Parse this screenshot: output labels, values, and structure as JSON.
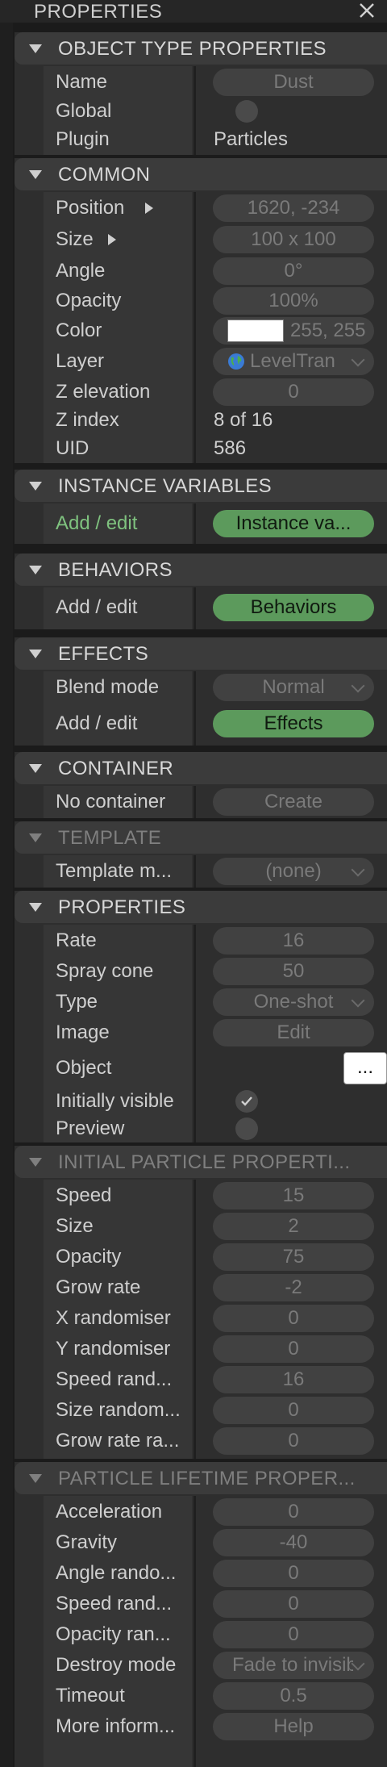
{
  "panel": {
    "title": "PROPERTIES"
  },
  "object_type": {
    "header": "OBJECT TYPE PROPERTIES",
    "name_label": "Name",
    "name_value": "Dust",
    "global_label": "Global",
    "plugin_label": "Plugin",
    "plugin_value": "Particles"
  },
  "common": {
    "header": "COMMON",
    "position_label": "Position",
    "position_value": "1620, -234",
    "size_label": "Size",
    "size_value": "100 x 100",
    "angle_label": "Angle",
    "angle_value": "0°",
    "opacity_label": "Opacity",
    "opacity_value": "100%",
    "color_label": "Color",
    "color_value": "255, 255",
    "color_swatch": "#ffffff",
    "layer_label": "Layer",
    "layer_value": "LevelTran",
    "zelev_label": "Z elevation",
    "zelev_value": "0",
    "zindex_label": "Z index",
    "zindex_value": "8 of 16",
    "uid_label": "UID",
    "uid_value": "586"
  },
  "instance_vars": {
    "header": "INSTANCE VARIABLES",
    "add_label": "Add / edit",
    "button": "Instance va..."
  },
  "behaviors": {
    "header": "BEHAVIORS",
    "add_label": "Add / edit",
    "button": "Behaviors"
  },
  "effects": {
    "header": "EFFECTS",
    "blend_label": "Blend mode",
    "blend_value": "Normal",
    "add_label": "Add / edit",
    "button": "Effects"
  },
  "container": {
    "header": "CONTAINER",
    "label": "No container",
    "button": "Create"
  },
  "template": {
    "header": "TEMPLATE",
    "label": "Template m...",
    "value": "(none)"
  },
  "properties": {
    "header": "PROPERTIES",
    "rate_label": "Rate",
    "rate_value": "16",
    "spray_label": "Spray cone",
    "spray_value": "50",
    "type_label": "Type",
    "type_value": "One-shot",
    "image_label": "Image",
    "image_button": "Edit",
    "object_label": "Object",
    "object_button": "...",
    "visible_label": "Initially visible",
    "preview_label": "Preview"
  },
  "initial": {
    "header": "INITIAL PARTICLE PROPERTI...",
    "rows": [
      {
        "label": "Speed",
        "value": "15"
      },
      {
        "label": "Size",
        "value": "2"
      },
      {
        "label": "Opacity",
        "value": "75"
      },
      {
        "label": "Grow rate",
        "value": "-2"
      },
      {
        "label": "X randomiser",
        "value": "0"
      },
      {
        "label": "Y randomiser",
        "value": "0"
      },
      {
        "label": "Speed rand...",
        "value": "16"
      },
      {
        "label": "Size random...",
        "value": "0"
      },
      {
        "label": "Grow rate ra...",
        "value": "0"
      }
    ]
  },
  "lifetime": {
    "header": "PARTICLE LIFETIME PROPER...",
    "rows": [
      {
        "label": "Acceleration",
        "value": "0"
      },
      {
        "label": "Gravity",
        "value": "-40"
      },
      {
        "label": "Angle rando...",
        "value": "0"
      },
      {
        "label": "Speed rand...",
        "value": "0"
      },
      {
        "label": "Opacity ran...",
        "value": "0"
      }
    ],
    "destroy_label": "Destroy mode",
    "destroy_value": "Fade to invisible",
    "timeout_label": "Timeout",
    "timeout_value": "0.5",
    "more_label": "More inform...",
    "more_button": "Help"
  }
}
